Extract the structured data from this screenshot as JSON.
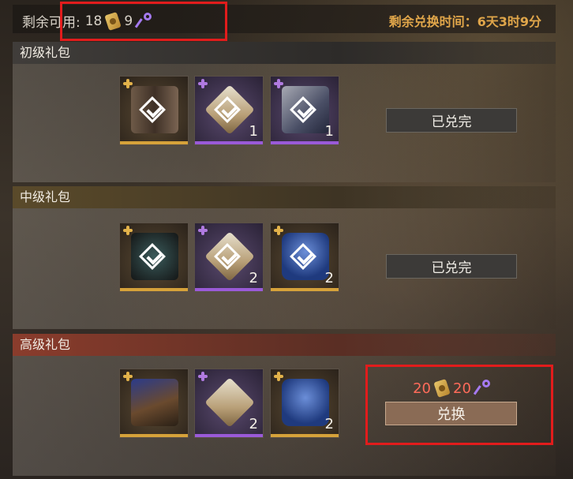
{
  "header": {
    "remaining_label": "剩余可用:",
    "tickets": "18",
    "keys": "9",
    "time_label": "剩余兑换时间：",
    "time_value": "6天3时9分"
  },
  "packs": [
    {
      "name": "初级礼包",
      "items": [
        {
          "quality": "gold",
          "icon": "wood-chest-icon",
          "count": "",
          "claimed": true
        },
        {
          "quality": "purple",
          "icon": "ornate-cube-icon",
          "count": "1",
          "claimed": true
        },
        {
          "quality": "purple",
          "icon": "steel-chest-icon",
          "count": "1",
          "claimed": true
        }
      ],
      "button": "已兑完"
    },
    {
      "name": "中级礼包",
      "items": [
        {
          "quality": "gold",
          "icon": "dark-relic-icon",
          "count": "",
          "claimed": true
        },
        {
          "quality": "purple",
          "icon": "ornate-cube-icon",
          "count": "2",
          "claimed": true
        },
        {
          "quality": "gold",
          "icon": "gift-bag-icon",
          "count": "2",
          "claimed": true
        }
      ],
      "button": "已兑完"
    },
    {
      "name": "高级礼包",
      "items": [
        {
          "quality": "gold",
          "icon": "weapon-icon",
          "count": "",
          "claimed": false
        },
        {
          "quality": "purple",
          "icon": "ornate-cube-icon",
          "count": "2",
          "claimed": false
        },
        {
          "quality": "gold",
          "icon": "gift-bag-icon",
          "count": "2",
          "claimed": false
        }
      ],
      "cost_tickets": "20",
      "cost_keys": "20",
      "button": "兑换"
    }
  ],
  "colors": {
    "highlight": "#e21c1c",
    "timer": "#e0a64a",
    "cost": "#ff6b5a"
  }
}
